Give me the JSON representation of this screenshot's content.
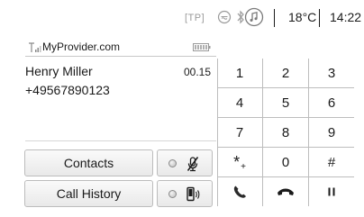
{
  "status_bar": {
    "tp_label": "[TP]",
    "bluetooth_icon": "bluetooth-icon",
    "volume_icon": "volume-mute-icon",
    "media_icon": "music-note-icon",
    "temperature": "18°C",
    "time": "14:22"
  },
  "call_info": {
    "provider": "MyProvider.com",
    "signal_icon": "signal-strength-icon",
    "battery_icon": "battery-icon",
    "caller_name": "Henry Miller",
    "duration": "00.15",
    "caller_number": "+49567890123"
  },
  "keypad": {
    "keys": [
      "1",
      "2",
      "3",
      "4",
      "5",
      "6",
      "7",
      "8",
      "9",
      "*",
      "0",
      "#"
    ],
    "star_sub": "+",
    "call_icon": "phone-call-icon",
    "end_call_icon": "end-call-icon",
    "hold_icon": "pause-icon"
  },
  "buttons": {
    "contacts_label": "Contacts",
    "call_history_label": "Call History",
    "mute_icon": "microphone-mute-icon",
    "handset_icon": "phone-handset-transfer-icon"
  }
}
